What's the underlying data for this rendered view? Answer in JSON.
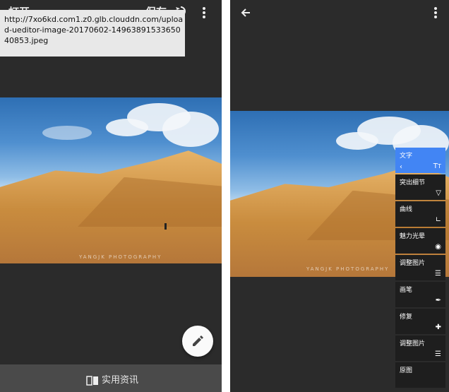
{
  "left": {
    "topbar": {
      "open_label": "打开",
      "save_label": "保存"
    },
    "tooltip_url": "http://7xo6kd.com1.z0.glb.clouddn.com/upload-ueditor-image-20170602-1496389153365040853.jpeg",
    "watermark": "YANGJK PHOTOGRAPHY",
    "bottom_label": "实用资讯"
  },
  "right": {
    "watermark": "YANGJK PHOTOGRAPHY",
    "tools": [
      {
        "label": "文字",
        "icon": "text-icon",
        "active": true
      },
      {
        "label": "突出细节",
        "icon": "triangle-down-icon"
      },
      {
        "label": "曲线",
        "icon": "curves-icon"
      },
      {
        "label": "魅力光晕",
        "icon": "eye-icon"
      },
      {
        "label": "调整图片",
        "icon": "sliders-icon"
      },
      {
        "label": "画笔",
        "icon": "brush-icon"
      },
      {
        "label": "修复",
        "icon": "bandage-icon"
      },
      {
        "label": "调整图片",
        "icon": "sliders-icon"
      },
      {
        "label": "原图",
        "icon": ""
      }
    ]
  },
  "colors": {
    "accent": "#4285f4",
    "background": "#2b2b2b"
  }
}
